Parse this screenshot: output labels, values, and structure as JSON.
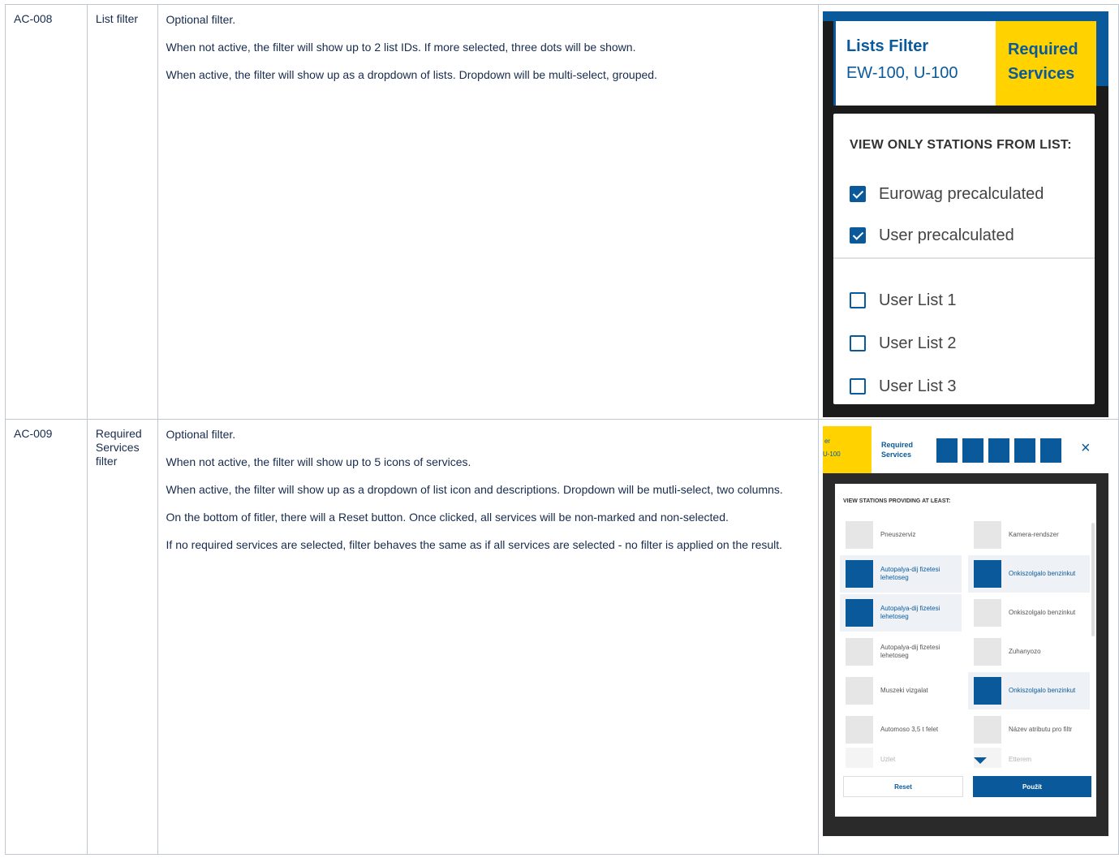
{
  "rows": [
    {
      "id": "AC-008",
      "name": "List filter",
      "desc": [
        "Optional filter.",
        "When not active, the filter will show up to 2 list IDs. If more selected, three dots will be shown.",
        "When active, the filter will show up as a dropdown of lists. Dropdown will be multi-select, grouped."
      ],
      "shot": {
        "lists_filter_title": "Lists Filter",
        "lists_filter_value": "EW-100, U-100",
        "required_services_title_1": "Required",
        "required_services_title_2": "Services",
        "dropdown_heading": "VIEW ONLY STATIONS FROM LIST:",
        "items": [
          {
            "label": "Eurowag precalculated",
            "checked": true
          },
          {
            "label": "User precalculated",
            "checked": true
          },
          {
            "label": "User List 1",
            "checked": false
          },
          {
            "label": "User List 2",
            "checked": false
          },
          {
            "label": "User List 3",
            "checked": false
          }
        ]
      }
    },
    {
      "id": "AC-009",
      "name": "Required Services filter",
      "desc": [
        "Optional filter.",
        "When not active, the filter will show up to 5 icons of services.",
        "When active, the filter will show up as a dropdown of list icon and descriptions. Dropdown will be mutli-select, two columns.",
        "On the bottom of fitler, there will a Reset button. Once clicked, all services will be non-marked and non-selected.",
        "If no required services are selected, filter behaves the same as if all services are selected - no filter is applied on the result."
      ],
      "shot": {
        "left_partial_1": "er",
        "left_partial_2": "U-100",
        "required_1": "Required",
        "required_2": "Services",
        "close_icon": "×",
        "panel_title": "VIEW STATIONS PROVIDING AT LEAST:",
        "services_left": [
          {
            "label": "Pneuszerviz",
            "selected": false
          },
          {
            "label": "Autopalya-dij fizetesi lehetoseg",
            "selected": true
          },
          {
            "label": "Autopalya-dij fizetesi lehetoseg",
            "selected": true
          },
          {
            "label": "Autopalya-dij fizetesi lehetoseg",
            "selected": false
          },
          {
            "label": "Muszeki vizgalat",
            "selected": false
          },
          {
            "label": "Automoso 3,5 t felet",
            "selected": false
          },
          {
            "label": "Uzlet",
            "selected": false
          }
        ],
        "services_right": [
          {
            "label": "Kamera-rendszer",
            "selected": false
          },
          {
            "label": "Onkiszolgalo benzinkut",
            "selected": true
          },
          {
            "label": "Onkiszolgalo benzinkut",
            "selected": false
          },
          {
            "label": "Zuhanyozo",
            "selected": false
          },
          {
            "label": "Onkiszolgalo benzinkut",
            "selected": true
          },
          {
            "label": "Název atributu pro filtr",
            "selected": false
          },
          {
            "label": "Etterem",
            "selected": false
          }
        ],
        "reset_label": "Reset",
        "apply_label": "Použít"
      }
    }
  ]
}
